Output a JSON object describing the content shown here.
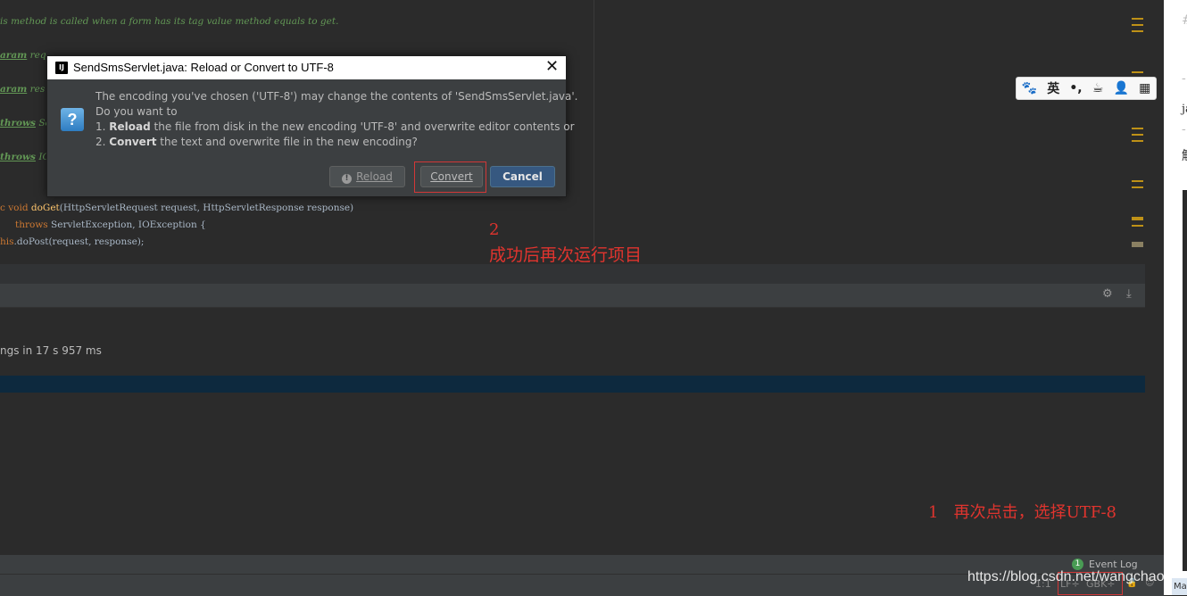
{
  "editor": {
    "lines": [
      {
        "text": "is method is called when a form has its tag value method equals to get."
      },
      {
        "tag": "aram",
        "rest": " req"
      },
      {
        "tag": "aram",
        "rest": " res"
      },
      {
        "tag": "throws",
        "rest": " Se"
      },
      {
        "tag": "throws",
        "rest": " IO"
      }
    ],
    "sig_prefix": "c void ",
    "sig_fn": "doGet",
    "sig_rest": "(HttpServletRequest request, HttpServletResponse response)",
    "throws_kw": "throws",
    "throws_rest": " ServletException, IOException {",
    "call_this": "his",
    "call_rest": ".doPost(request, response);"
  },
  "dialog": {
    "title": "SendSmsServlet.java: Reload or Convert to UTF-8",
    "app_icon": "IJ",
    "close": "✕",
    "question_icon": "?",
    "line1": "The encoding you've chosen ('UTF-8') may change the contents of 'SendSmsServlet.java'.",
    "line2": "Do you want to",
    "line3_num": "1. ",
    "line3_bold": "Reload",
    "line3_rest": " the file from disk in the new encoding 'UTF-8' and overwrite editor contents or",
    "line4_num": "2. ",
    "line4_bold": "Convert",
    "line4_rest": " the text and overwrite file in the new encoding?",
    "buttons": {
      "reload": "Reload",
      "convert": "Convert",
      "cancel": "Cancel"
    }
  },
  "tool_window": {
    "build_text": "ngs in 17 s 957 ms",
    "gear_icon": "⚙",
    "download_icon": "⤓"
  },
  "status": {
    "event_count": "1",
    "event_log": "Event Log",
    "position": "1:1",
    "line_sep": "LF÷",
    "encoding": "GBK÷",
    "lock_icon": "🔒",
    "face_icon": "☺"
  },
  "watermark": "https://blog.csdn.net/wangchaoni",
  "ime": {
    "paw_icon": "🐾",
    "lang": "英",
    "punct": "•,",
    "cup_icon": "☕",
    "user_icon": "👤",
    "grid_icon": "▦"
  },
  "right_panel": {
    "chars": [
      "#",
      "-",
      "ja",
      "-",
      "解"
    ],
    "tab_label": "Ma"
  },
  "annotations": {
    "num2": "2",
    "text2": "成功后再次运行项目",
    "text1": "1   再次点击，选择UTF-8"
  },
  "colors": {
    "annotation_red": "#e0342e",
    "highlight_box": "#d23737",
    "cancel_blue": "#365880"
  }
}
